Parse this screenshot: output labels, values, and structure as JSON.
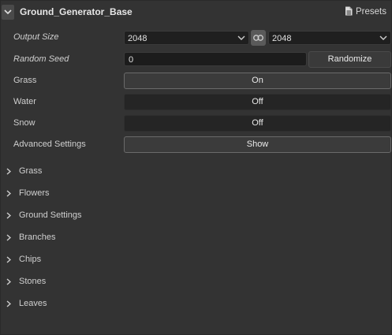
{
  "header": {
    "title": "Ground_Generator_Base",
    "presets_label": "Presets"
  },
  "params": {
    "output_size_label": "Output Size",
    "output_width": "2048",
    "output_height": "2048",
    "random_seed_label": "Random Seed",
    "random_seed_value": "0",
    "randomize_label": "Randomize",
    "grass_label": "Grass",
    "grass_value": "On",
    "water_label": "Water",
    "water_value": "Off",
    "snow_label": "Snow",
    "snow_value": "Off",
    "advanced_label": "Advanced Settings",
    "advanced_value": "Show"
  },
  "sections": [
    "Grass",
    "Flowers",
    "Ground Settings",
    "Branches",
    "Chips",
    "Stones",
    "Leaves"
  ],
  "colors": {
    "background": "#333333",
    "field": "#1f1f1f",
    "text": "#d4d4d4"
  },
  "icons": {
    "collapse": "chevron-down-icon",
    "presets": "document-icon",
    "link": "link-icon",
    "section": "chevron-right-icon"
  }
}
